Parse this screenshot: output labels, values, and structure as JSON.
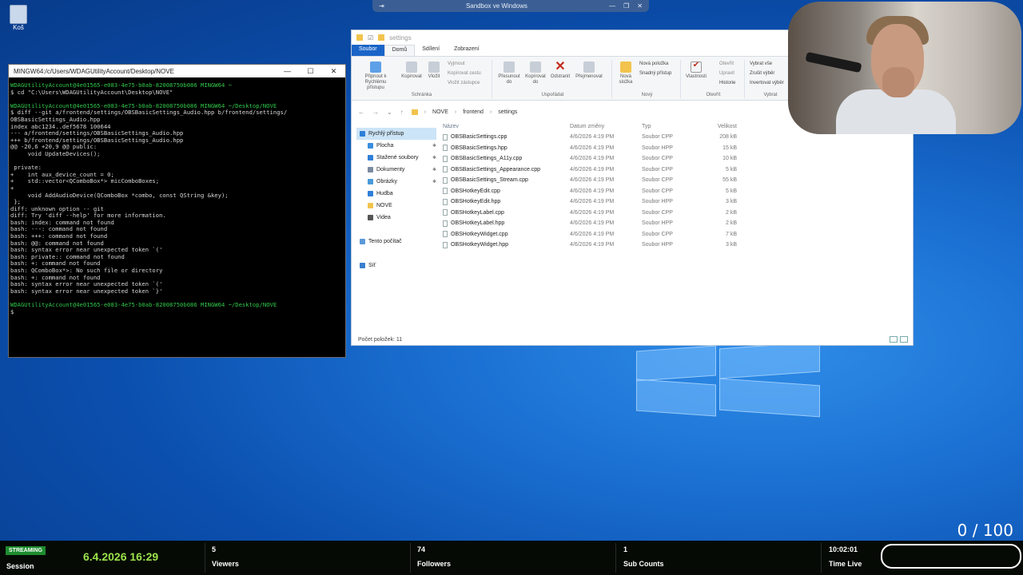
{
  "desktop": {
    "recycle_label": "Koš"
  },
  "sandbox": {
    "title": "Sandbox ve Windows"
  },
  "terminal": {
    "title": "MINGW64:/c/Users/WDAGUtilityAccount/Desktop/NOVE",
    "lines": [
      {
        "cls": "g",
        "text": "WDAGUtilityAccount@4e01565-e083-4e75-b0ab-82008750b086 MINGW64 ~"
      },
      {
        "cls": "",
        "text": "$ cd \"C:\\Users\\WDAGUtilityAccount\\Desktop\\NOVE\""
      },
      {
        "cls": "",
        "text": ""
      },
      {
        "cls": "g",
        "text": "WDAGUtilityAccount@4e01565-e083-4e75-b0ab-82008750b086 MINGW64 ~/Desktop/NOVE"
      },
      {
        "cls": "",
        "text": "$ diff --git a/frontend/settings/OBSBasicSettings_Audio.hpp b/frontend/settings/"
      },
      {
        "cls": "",
        "text": "OBSBasicSettings_Audio.hpp"
      },
      {
        "cls": "",
        "text": "index abc1234..def5678 100644"
      },
      {
        "cls": "",
        "text": "--- a/frontend/settings/OBSBasicSettings_Audio.hpp"
      },
      {
        "cls": "",
        "text": "+++ b/frontend/settings/OBSBasicSettings_Audio.hpp"
      },
      {
        "cls": "",
        "text": "@@ -20,6 +20,9 @@ public:"
      },
      {
        "cls": "",
        "text": "     void UpdateDevices();"
      },
      {
        "cls": "",
        "text": ""
      },
      {
        "cls": "",
        "text": " private:"
      },
      {
        "cls": "",
        "text": "+    int aux_device_count = 0;"
      },
      {
        "cls": "",
        "text": "+    std::vector<QComboBox*> micComboBoxes;"
      },
      {
        "cls": "",
        "text": "+"
      },
      {
        "cls": "",
        "text": "     void AddAudioDevice(QComboBox *combo, const QString &key);"
      },
      {
        "cls": "",
        "text": " };"
      },
      {
        "cls": "",
        "text": "diff: unknown option -- git"
      },
      {
        "cls": "",
        "text": "diff: Try 'diff --help' for more information."
      },
      {
        "cls": "",
        "text": "bash: index: command not found"
      },
      {
        "cls": "",
        "text": "bash: ---: command not found"
      },
      {
        "cls": "",
        "text": "bash: +++: command not found"
      },
      {
        "cls": "",
        "text": "bash: @@: command not found"
      },
      {
        "cls": "",
        "text": "bash: syntax error near unexpected token `('"
      },
      {
        "cls": "",
        "text": "bash: private:: command not found"
      },
      {
        "cls": "",
        "text": "bash: +: command not found"
      },
      {
        "cls": "",
        "text": "bash: QComboBox*>: No such file or directory"
      },
      {
        "cls": "",
        "text": "bash: +: command not found"
      },
      {
        "cls": "",
        "text": "bash: syntax error near unexpected token `('"
      },
      {
        "cls": "",
        "text": "bash: syntax error near unexpected token `}'"
      },
      {
        "cls": "",
        "text": ""
      },
      {
        "cls": "g",
        "text": "WDAGUtilityAccount@4e01565-e083-4e75-b0ab-82008750b086 MINGW64 ~/Desktop/NOVE"
      },
      {
        "cls": "",
        "text": "$"
      }
    ]
  },
  "explorer": {
    "title": "settings",
    "tabs": [
      "Soubor",
      "Domů",
      "Sdílení",
      "Zobrazení"
    ],
    "ribbon": {
      "pin": "Připnout k Rychlému přístupu",
      "copy": "Kopírovat",
      "paste": "Vložit",
      "cut": "Vyjmout",
      "copy_path": "Kopírovat cestu",
      "paste_shortcut": "Vložit zástupce",
      "clipboard": "Schránka",
      "move_to": "Přesunout do",
      "copy_to": "Kopírovat do",
      "delete": "Odstranit",
      "rename": "Přejmenovat",
      "organize": "Uspořádat",
      "new_folder": "Nová složka",
      "new_item": "Nová položka",
      "easy_access": "Snadný přístup",
      "new_group": "Nový",
      "properties": "Vlastnosti",
      "open": "Otevřít",
      "edit": "Upravit",
      "history": "Historie",
      "open_group": "Otevřít",
      "select_all": "Vybrat vše",
      "select_none": "Zrušit výběr",
      "invert": "Invertovat výběr",
      "select_group": "Vybrat"
    },
    "path": [
      "NOVE",
      "frontend",
      "settings"
    ],
    "nav": [
      {
        "label": "Rychlý přístup",
        "color": "#2f7fd8",
        "pin": false,
        "sel": true
      },
      {
        "label": "Plocha",
        "color": "#3a8ee0",
        "pin": true
      },
      {
        "label": "Stažené soubory",
        "color": "#2f7fd8",
        "pin": true
      },
      {
        "label": "Dokumenty",
        "color": "#7a8aa0",
        "pin": true
      },
      {
        "label": "Obrázky",
        "color": "#4a9ad8",
        "pin": true
      },
      {
        "label": "Hudba",
        "color": "#2f7fd8",
        "pin": false
      },
      {
        "label": "NOVE",
        "color": "#f2c44d",
        "pin": false
      },
      {
        "label": "Videa",
        "color": "#555",
        "pin": false
      },
      {
        "label": "",
        "color": "",
        "pin": false
      },
      {
        "label": "Tento počítač",
        "color": "#5a9ad8",
        "pin": false
      },
      {
        "label": "",
        "color": "",
        "pin": false
      },
      {
        "label": "Síť",
        "color": "#3a7fd0",
        "pin": false
      }
    ],
    "columns": [
      "Název",
      "Datum změny",
      "Typ",
      "Velikost"
    ],
    "files": [
      {
        "name": "OBSBasicSettings.cpp",
        "date": "4/6/2026 4:19 PM",
        "type": "Soubor CPP",
        "size": "208 kB"
      },
      {
        "name": "OBSBasicSettings.hpp",
        "date": "4/6/2026 4:19 PM",
        "type": "Soubor HPP",
        "size": "15 kB"
      },
      {
        "name": "OBSBasicSettings_A11y.cpp",
        "date": "4/6/2026 4:19 PM",
        "type": "Soubor CPP",
        "size": "10 kB"
      },
      {
        "name": "OBSBasicSettings_Appearance.cpp",
        "date": "4/6/2026 4:19 PM",
        "type": "Soubor CPP",
        "size": "5 kB"
      },
      {
        "name": "OBSBasicSettings_Stream.cpp",
        "date": "4/6/2026 4:19 PM",
        "type": "Soubor CPP",
        "size": "55 kB"
      },
      {
        "name": "OBSHotkeyEdit.cpp",
        "date": "4/6/2026 4:19 PM",
        "type": "Soubor CPP",
        "size": "5 kB"
      },
      {
        "name": "OBSHotkeyEdit.hpp",
        "date": "4/6/2026 4:19 PM",
        "type": "Soubor HPP",
        "size": "3 kB"
      },
      {
        "name": "OBSHotkeyLabel.cpp",
        "date": "4/6/2026 4:19 PM",
        "type": "Soubor CPP",
        "size": "2 kB"
      },
      {
        "name": "OBSHotkeyLabel.hpp",
        "date": "4/6/2026 4:19 PM",
        "type": "Soubor HPP",
        "size": "2 kB"
      },
      {
        "name": "OBSHotkeyWidget.cpp",
        "date": "4/6/2026 4:19 PM",
        "type": "Soubor CPP",
        "size": "7 kB"
      },
      {
        "name": "OBSHotkeyWidget.hpp",
        "date": "4/6/2026 4:19 PM",
        "type": "Soubor HPP",
        "size": "3 kB"
      }
    ],
    "status": "Počet položek: 11"
  },
  "overlay": {
    "counter": "0 / 100",
    "badge": "STREAMING",
    "session_label": "Session",
    "datetime": "6.4.2026 16:29",
    "viewers_value": "5",
    "viewers_label": "Viewers",
    "followers_value": "74",
    "followers_label": "Followers",
    "subs_value": "1",
    "subs_label": "Sub Counts",
    "time_value": "10:02:01",
    "time_label": "Time Live"
  }
}
